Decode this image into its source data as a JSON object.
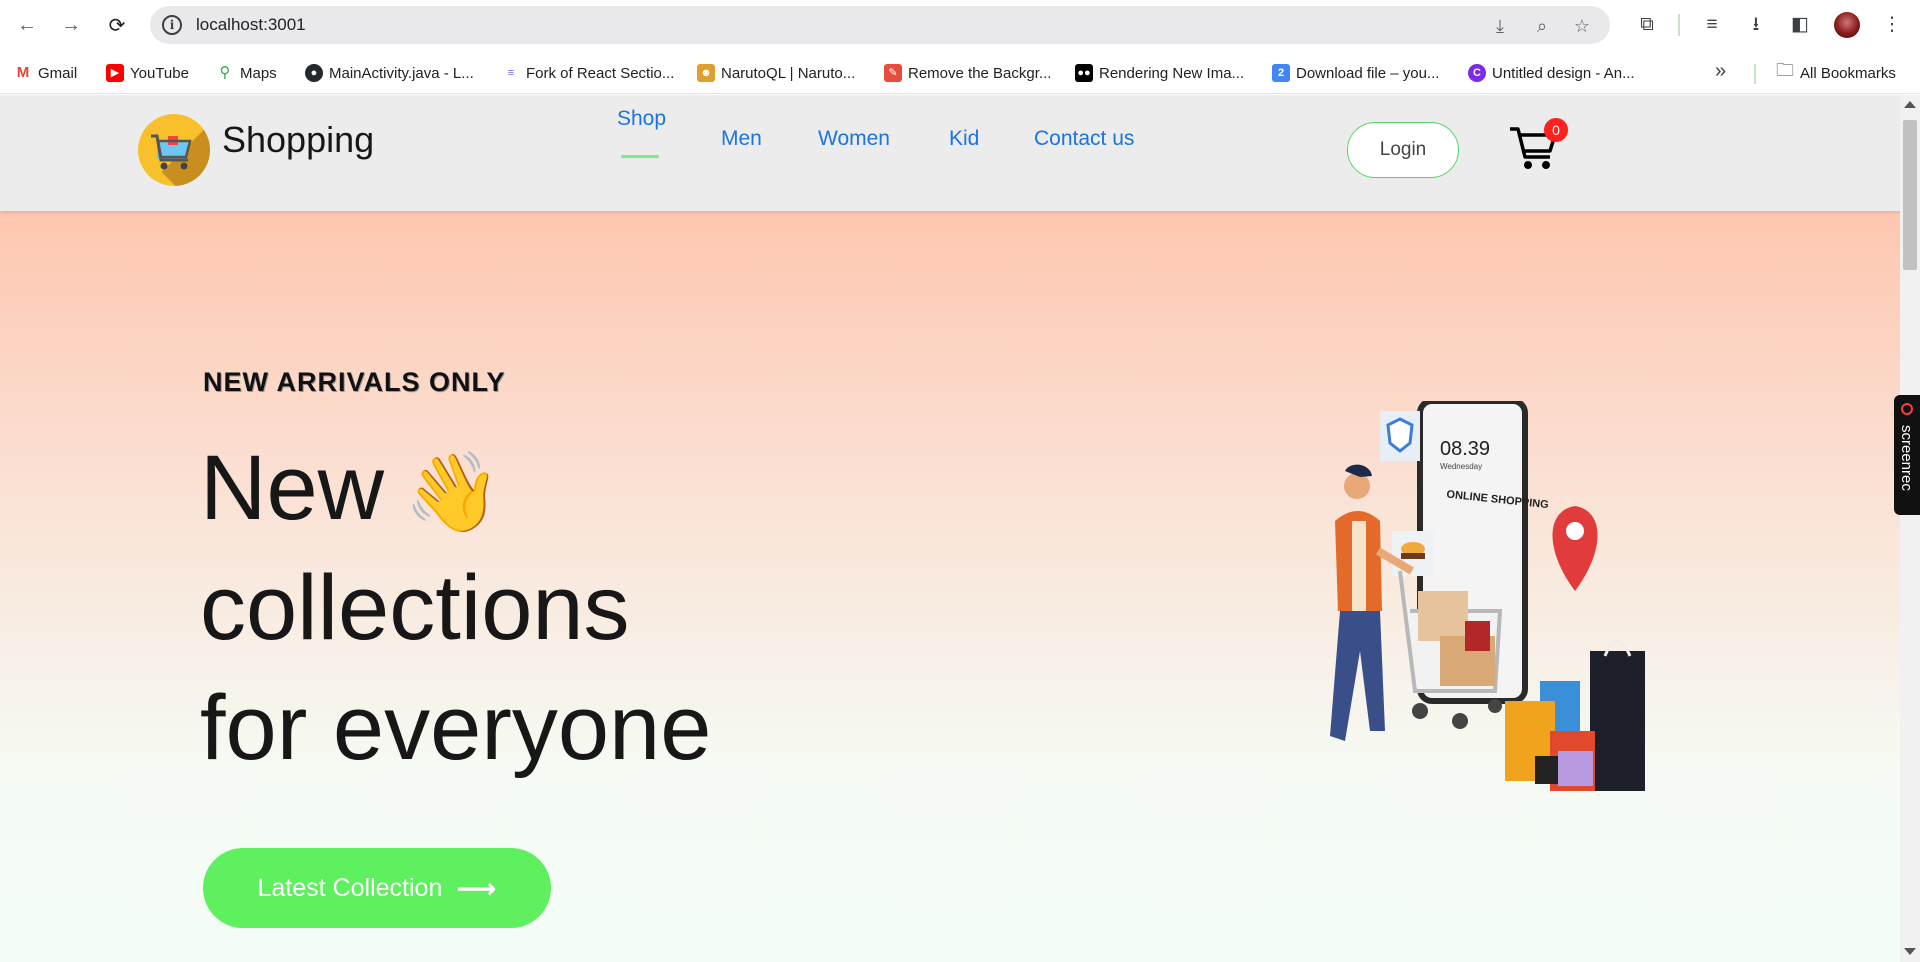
{
  "browser": {
    "url": "localhost:3001",
    "nav": {
      "back": "←",
      "forward": "→",
      "reload": "⟳"
    }
  },
  "bookmarks": [
    {
      "label": "Gmail",
      "icon": "gmail-icon",
      "color": "#ea4335"
    },
    {
      "label": "YouTube",
      "icon": "youtube-icon",
      "color": "#ff0000"
    },
    {
      "label": "Maps",
      "icon": "maps-icon",
      "color": "#34a853"
    },
    {
      "label": "MainActivity.java - L...",
      "icon": "github-icon",
      "color": "#24292f"
    },
    {
      "label": "Fork of React Sectio...",
      "icon": "fork-icon",
      "color": "#7b68ee"
    },
    {
      "label": "NarutoQL | Naruto...",
      "icon": "naruto-icon",
      "color": "#e0a030"
    },
    {
      "label": "Remove the Backgr...",
      "icon": "wrench-icon",
      "color": "#e74c3c"
    },
    {
      "label": "Rendering New Ima...",
      "icon": "medium-icon",
      "color": "#000000"
    },
    {
      "label": "Download file – you...",
      "icon": "download-file-icon",
      "color": "#4285f4"
    },
    {
      "label": "Untitled design - An...",
      "icon": "canva-icon",
      "color": "#7d2ae8"
    }
  ],
  "all_bookmarks": "All Bookmarks",
  "site": {
    "brand": "Shopping",
    "menu": [
      "Shop",
      "Men",
      "Women",
      "Kid",
      "Contact us"
    ],
    "active_menu": "Shop",
    "login": "Login",
    "cart_count": "0"
  },
  "hero": {
    "kicker": "NEW ARRIVALS ONLY",
    "line1": "New",
    "wave": "👋",
    "line2": "collections",
    "line3": "for everyone",
    "cta": "Latest Collection",
    "cta_arrow": "⟶",
    "illustration_text": {
      "time": "08.39",
      "day": "Wednesday",
      "caption": "ONLINE SHOPPING"
    }
  },
  "overlay": {
    "screenrec": "screenrec"
  },
  "colors": {
    "accent_green": "#5ef05e",
    "link_blue": "#1a73e8",
    "badge_red": "#ff1f1f"
  }
}
